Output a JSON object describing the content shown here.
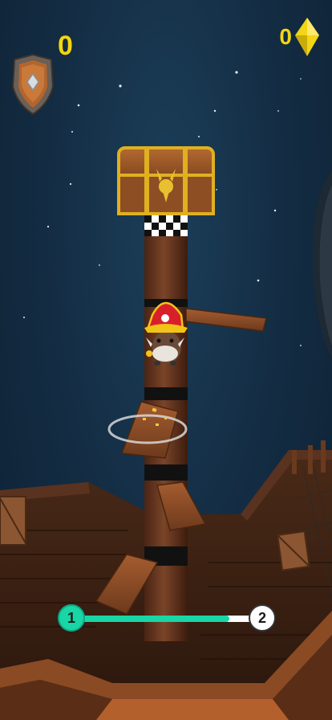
{
  "hud": {
    "score": "0",
    "gems": "0",
    "gem_icon": "yellow-diamond-icon",
    "shield_icon": "shield-badge-icon"
  },
  "progress": {
    "current_level": "1",
    "next_level": "2",
    "fill_fraction": 0.82,
    "fill_color": "#18d6a6"
  },
  "colors": {
    "sky": "#142e45",
    "hud_yellow": "#f2d516",
    "pole": "#6b3a22",
    "plank": "#8a4b28"
  }
}
